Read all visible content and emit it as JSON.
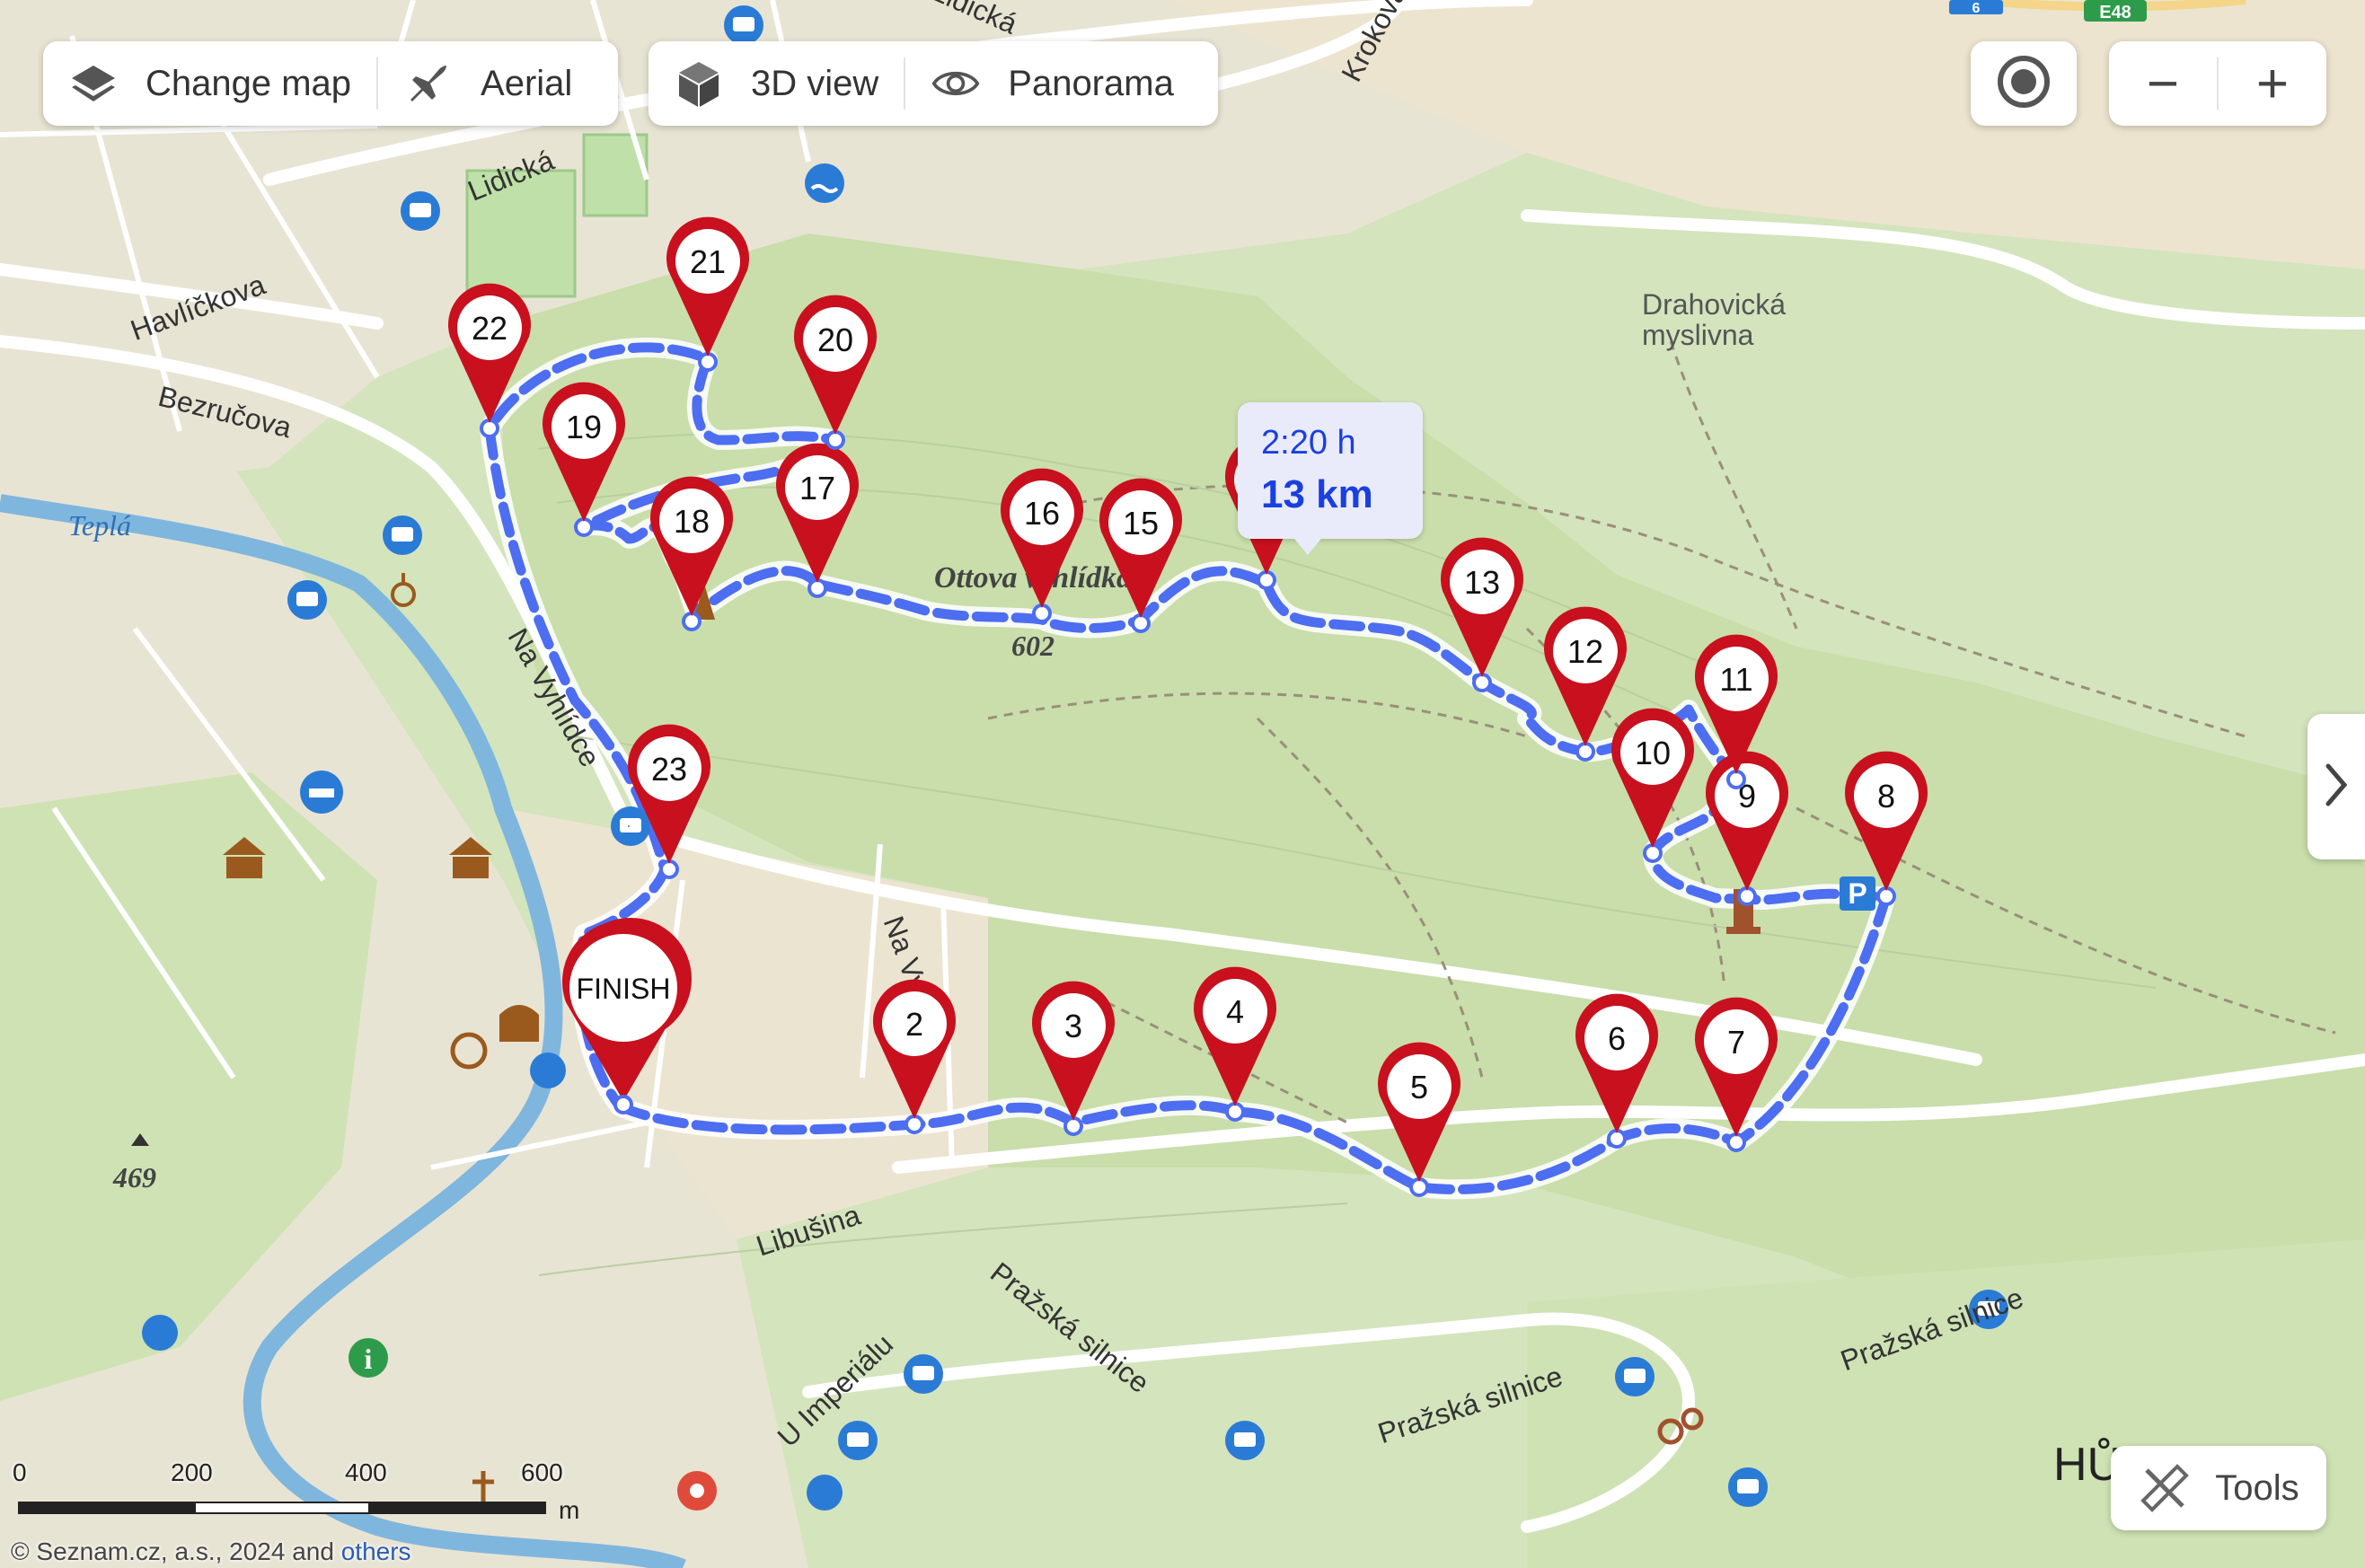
{
  "toolbar_left": {
    "change_map": "Change map",
    "aerial": "Aerial"
  },
  "toolbar_mid": {
    "view_3d": "3D view",
    "panorama": "Panorama"
  },
  "controls": {
    "zoom_out": "−",
    "zoom_in": "+"
  },
  "route_info": {
    "time": "2:20 h",
    "distance": "13 km"
  },
  "waypoints": [
    "2",
    "3",
    "4",
    "5",
    "6",
    "7",
    "8",
    "9",
    "10",
    "11",
    "12",
    "13",
    "14",
    "15",
    "16",
    "17",
    "18",
    "19",
    "20",
    "21",
    "22",
    "23"
  ],
  "finish_label": "FINISH",
  "labels": {
    "lidicka": "Lidická",
    "havlickova": "Havlíčkova",
    "bezrucova": "Bezručova",
    "tepla": "Teplá",
    "na_vyhlidce": "Na Vyhlídce",
    "na_vyhl": "Na Vyhl",
    "libusina": "Libušina",
    "prazska1": "Pražská silnice",
    "prazska2": "Pražská silnice",
    "prazska3": "Pražská silnice",
    "u_imperialu": "U Imperiálu",
    "krokova": "Krokova",
    "lidicka_top": "Lidická",
    "drahovicka": "Drahovická",
    "myslivna": "myslivna",
    "ottova": "Ottova vyhlídka",
    "elev_602": "602",
    "elev_469": "469",
    "hurky": "HŮRKY",
    "e48": "E48",
    "road_6": "6"
  },
  "scale": {
    "ticks": [
      "0",
      "200",
      "400",
      "600"
    ],
    "unit": "m"
  },
  "copyright": {
    "text": "© Seznam.cz, a.s., 2024 and ",
    "others": "others"
  },
  "tools": "Tools",
  "colors": {
    "route": "#4d6ef0",
    "pin": "#c8101e",
    "forest": "#cfe0b4",
    "urban": "#e9e2cf",
    "water": "#7fb6de",
    "road": "#ffffff"
  }
}
